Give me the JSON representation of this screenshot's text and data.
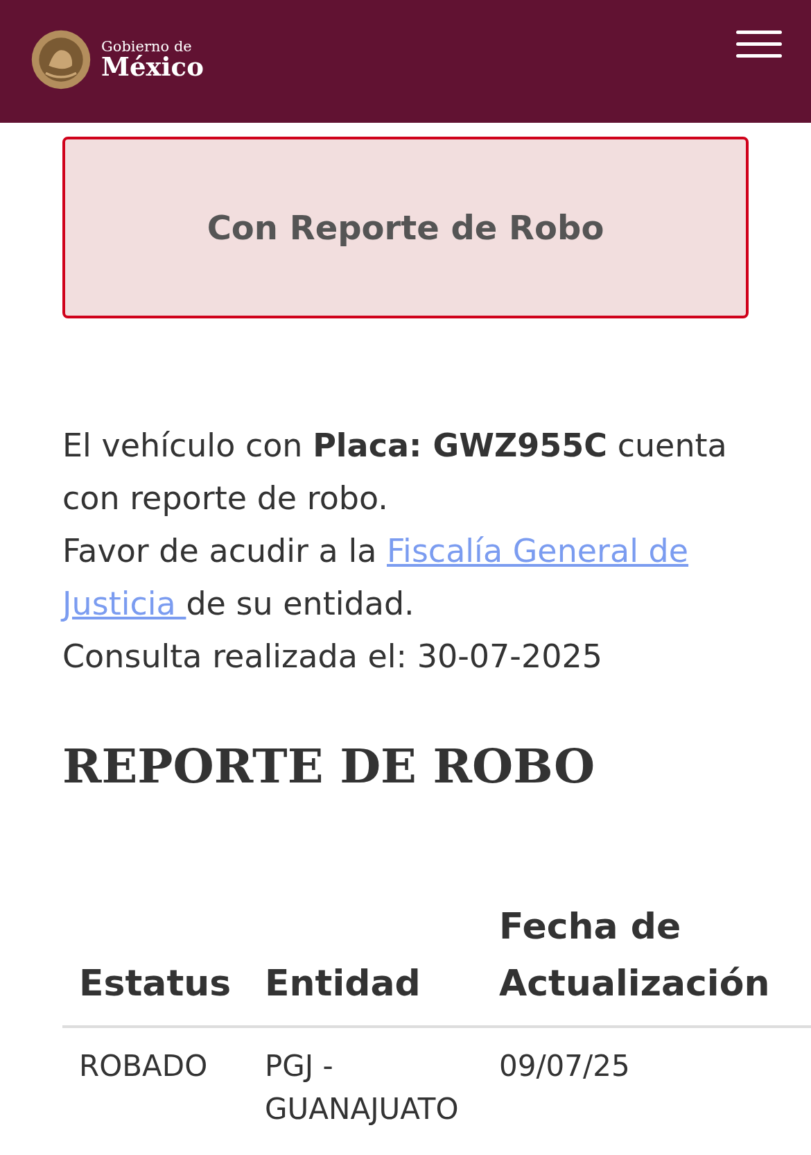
{
  "header": {
    "logo_line1": "Gobierno de",
    "logo_line2": "México"
  },
  "alert": {
    "title": "Con Reporte de Robo"
  },
  "message": {
    "line1": "El vehículo con **Placa: GWZ955C** cuenta con reporte de robo.",
    "line2_before": "Favor de acudir a la",
    "link": [
      "Fiscalía General de",
      "Justicia "
    ],
    "line2_after": "de su entidad.",
    "line3": "Consulta realizada el: 30-07-2025"
  },
  "section_title": "REPORTE DE ROBO",
  "table": {
    "columns": [
      "Estatus",
      "Entidad",
      "Fecha de Actualización"
    ],
    "rows": [
      [
        "ROBADO",
        "PGJ - GUANAJUATO",
        "09/07/25"
      ]
    ]
  }
}
